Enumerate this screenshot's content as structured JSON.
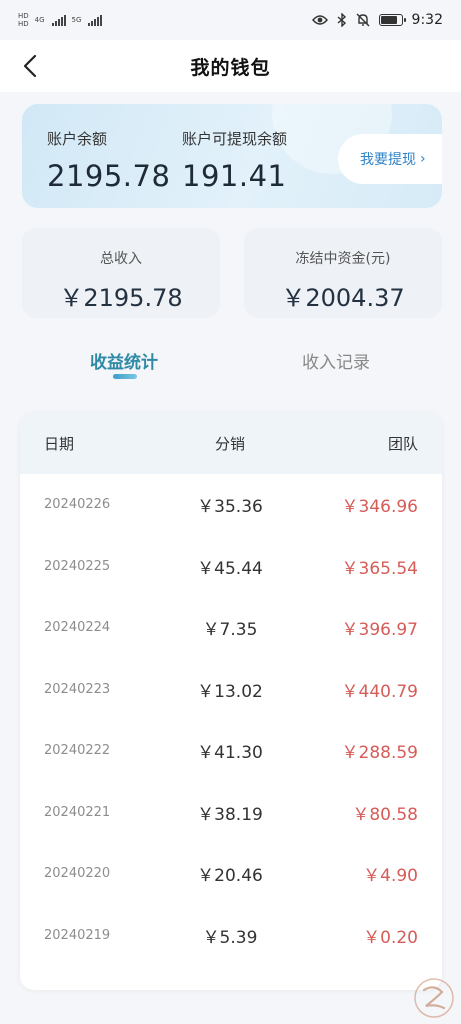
{
  "status_bar": {
    "sim1_label": "HD",
    "sim2_label": "HD",
    "net1": "4G",
    "net2": "5G",
    "time": "9:32",
    "battery_level": 0.8
  },
  "header": {
    "title": "我的钱包"
  },
  "balance": {
    "account_balance_label": "账户余额",
    "account_balance_value": "2195.78",
    "withdrawable_label": "账户可提现余额",
    "withdrawable_value": "191.41",
    "withdraw_button_label": "我要提现",
    "withdraw_chevron": "›"
  },
  "stats": {
    "total_income_label": "总收入",
    "total_income_value": "￥2195.78",
    "frozen_label": "冻结中资金(元)",
    "frozen_value": "￥2004.37"
  },
  "tabs": [
    {
      "label": "收益统计",
      "active": true
    },
    {
      "label": "收入记录",
      "active": false
    }
  ],
  "table": {
    "headers": [
      "日期",
      "分销",
      "团队"
    ],
    "rows": [
      {
        "date": "20240226",
        "distribution": "￥35.36",
        "team": "￥346.96"
      },
      {
        "date": "20240225",
        "distribution": "￥45.44",
        "team": "￥365.54"
      },
      {
        "date": "20240224",
        "distribution": "￥7.35",
        "team": "￥396.97"
      },
      {
        "date": "20240223",
        "distribution": "￥13.02",
        "team": "￥440.79"
      },
      {
        "date": "20240222",
        "distribution": "￥41.30",
        "team": "￥288.59"
      },
      {
        "date": "20240221",
        "distribution": "￥38.19",
        "team": "￥80.58"
      },
      {
        "date": "20240220",
        "distribution": "￥20.46",
        "team": "￥4.90"
      },
      {
        "date": "20240219",
        "distribution": "￥5.39",
        "team": "￥0.20"
      }
    ]
  },
  "colors": {
    "accent": "#2f8aa6",
    "team_value": "#d65c58",
    "withdraw_text": "#2f82c6"
  }
}
